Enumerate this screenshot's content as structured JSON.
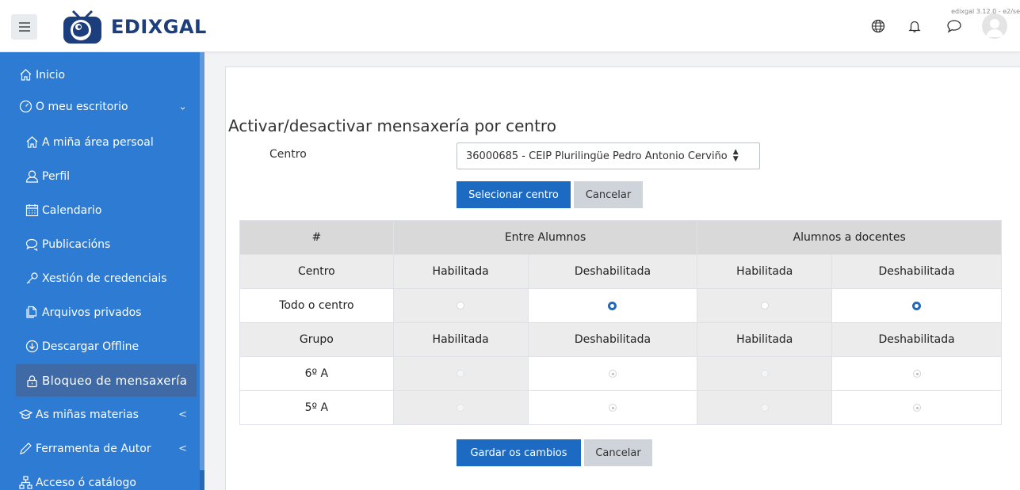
{
  "header": {
    "brand": "EDIXGAL",
    "version": "edixgal 3.12.0 - e2/se",
    "icons": [
      "globe-icon",
      "bell-icon",
      "chat-icon",
      "avatar"
    ]
  },
  "sidebar": {
    "items": [
      {
        "label": "Inicio",
        "icon": "home-icon"
      },
      {
        "label": "O meu escritorio",
        "icon": "dashboard-icon",
        "chevron": "⌄"
      },
      {
        "label": "A miña área persoal",
        "icon": "home-icon"
      },
      {
        "label": "Perfil",
        "icon": "user-icon"
      },
      {
        "label": "Calendario",
        "icon": "calendar-icon"
      },
      {
        "label": "Publicacións",
        "icon": "comments-icon"
      },
      {
        "label": "Xestión de credenciais",
        "icon": "key-icon"
      },
      {
        "label": "Arquivos privados",
        "icon": "files-icon"
      },
      {
        "label": "Descargar Offline",
        "icon": "download-icon"
      },
      {
        "label": "Bloqueo de mensaxería",
        "icon": "lock-icon"
      },
      {
        "label": "As miñas materias",
        "icon": "graduation-cap-icon",
        "chevron": "<"
      },
      {
        "label": "Ferramenta de Autor",
        "icon": "pencil-icon",
        "chevron": "<"
      },
      {
        "label": "Acceso ó catálogo",
        "icon": "sitemap-icon"
      }
    ]
  },
  "main": {
    "title": "Activar/desactivar mensaxería por centro",
    "centro_label": "Centro",
    "centro_value": "36000685 - CEIP Plurilingüe Pedro Antonio Cerviño",
    "select_button": "Selecionar centro",
    "cancel_button": "Cancelar",
    "save_button": "Gardar os cambios",
    "cancel_button_bottom": "Cancelar"
  },
  "table": {
    "head": [
      "#",
      "Entre Alumnos",
      "Alumnos a docentes"
    ],
    "sub1": [
      "Centro",
      "Habilitada",
      "Deshabilitada",
      "Habilitada",
      "Deshabilitada"
    ],
    "row_centre": {
      "label": "Todo o centro",
      "selected": [
        "Deshabilitada",
        "Deshabilitada"
      ]
    },
    "sub2": [
      "Grupo",
      "Habilitada",
      "Deshabilitada",
      "Habilitada",
      "Deshabilitada"
    ],
    "groups": [
      {
        "label": "6º A",
        "selected": [
          "Deshabilitada",
          "Deshabilitada"
        ],
        "disabled": true
      },
      {
        "label": "5º A",
        "selected": [
          "Deshabilitada",
          "Deshabilitada"
        ],
        "disabled": true
      }
    ]
  },
  "colors": {
    "sidebar": "#2e7bd3",
    "active_item": "#3f6aa6",
    "primary": "#1d6ac3",
    "brand_text": "#1d3e7d"
  }
}
